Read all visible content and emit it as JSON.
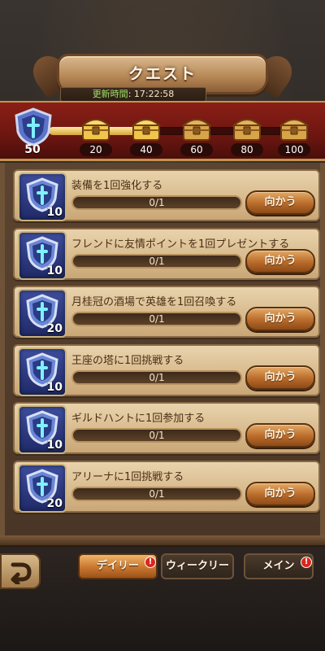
{
  "header": {
    "title": "クエスト",
    "timer_label": "更新時間",
    "timer_value": ": 17:22:58"
  },
  "progress": {
    "level": "50",
    "fill_fraction": 0.41,
    "milestones": [
      "20",
      "40",
      "60",
      "80",
      "100"
    ]
  },
  "quests": [
    {
      "title": "装備を1回強化する",
      "count": "10",
      "progress": "0/1",
      "button": "向かう"
    },
    {
      "title": "フレンドに友情ポイントを1回プレゼントする",
      "count": "10",
      "progress": "0/1",
      "button": "向かう"
    },
    {
      "title": "月桂冠の酒場で英雄を1回召喚する",
      "count": "20",
      "progress": "0/1",
      "button": "向かう"
    },
    {
      "title": "王座の塔に1回挑戦する",
      "count": "10",
      "progress": "0/1",
      "button": "向かう"
    },
    {
      "title": "ギルドハントに1回参加する",
      "count": "10",
      "progress": "0/1",
      "button": "向かう"
    },
    {
      "title": "アリーナに1回挑戦する",
      "count": "20",
      "progress": "0/1",
      "button": "向かう"
    }
  ],
  "tabs": [
    {
      "label": "デイリー",
      "active": true,
      "alert": "!"
    },
    {
      "label": "ウィークリー",
      "active": false,
      "alert": ""
    },
    {
      "label": "メイン",
      "active": false,
      "alert": "!"
    }
  ],
  "colors": {
    "accent": "#c8762e",
    "banner_red": "#8a1f16",
    "parchment": "#e9d3ac",
    "alert": "#d8281f"
  }
}
